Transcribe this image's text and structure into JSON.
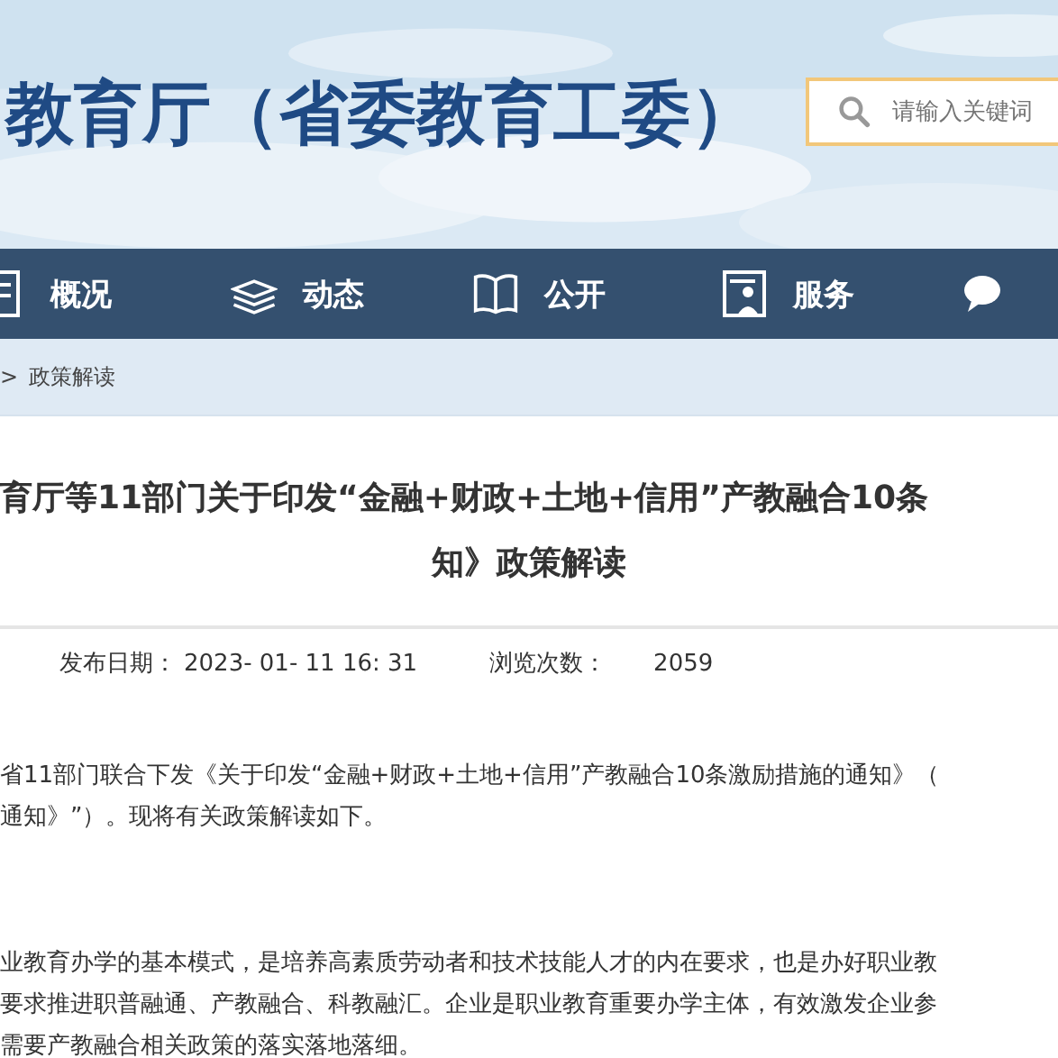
{
  "header": {
    "title": "教育厅（省委教育工委）",
    "search": {
      "placeholder": "请输入关键词"
    }
  },
  "nav": [
    {
      "label": "概况",
      "kind": "overview"
    },
    {
      "label": "动态",
      "kind": "news"
    },
    {
      "label": "公开",
      "kind": "open"
    },
    {
      "label": "服务",
      "kind": "service"
    },
    {
      "kind": "chat"
    }
  ],
  "breadcrumb": {
    "separator": ">",
    "current": "政策解读"
  },
  "article": {
    "title_lines": [
      "育厅等11部门关于印发“金融+财政+土地+信用”产教融合10条",
      "知》政策解读"
    ],
    "publish_label": "发布日期：",
    "publish_date": "2023- 01- 11 16: 31",
    "views_label": "浏览次数：",
    "views": "2059",
    "paragraphs": [
      [
        "省11部门联合下发《关于印发“金融+财政+土地+信用”产教融合10条激励措施的通知》（",
        "通知》”）。现将有关政策解读如下。"
      ],
      [
        "业教育办学的基本模式，是培养高素质劳动者和技术技能人才的内在要求，也是办好职业教",
        "要求推进职普融通、产教融合、科教融汇。企业是职业教育重要办学主体，有效激发企业参",
        "需要产教融合相关政策的落实落地落细。"
      ]
    ]
  }
}
